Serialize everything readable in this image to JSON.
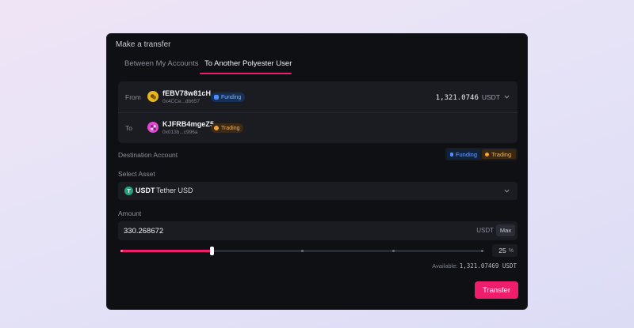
{
  "modal": {
    "title": "Make a transfer"
  },
  "tabs": [
    {
      "label": "Between My Accounts",
      "active": false
    },
    {
      "label": "To Another Polyester User",
      "active": true
    }
  ],
  "from": {
    "label": "From",
    "name": "fEBV78w81cH",
    "address": "0x4CCe...db657",
    "badge": "Funding",
    "balance": "1,321.0746",
    "balance_unit": "USDT",
    "icon": "coins-icon"
  },
  "to": {
    "label": "To",
    "name": "KJFRB4mgeZ5",
    "address": "0x013b...c996a",
    "badge": "Trading",
    "icon": "avatar-icon"
  },
  "destination": {
    "label": "Destination Account",
    "options": [
      "Funding",
      "Trading"
    ],
    "selected": "Trading"
  },
  "asset": {
    "label": "Select Asset",
    "symbol": "USDT",
    "name": "Tether USD",
    "icon_glyph": "T"
  },
  "amount": {
    "label": "Amount",
    "value": "330.268672",
    "unit": "USDT",
    "max_label": "Max",
    "percent": 25,
    "percent_sign": "%",
    "available_label": "Available:",
    "available_value": "1,321.07469 USDT"
  },
  "slider": {
    "marks": [
      0,
      25,
      50,
      75,
      100
    ]
  },
  "submit": {
    "label": "Transfer"
  },
  "colors": {
    "accent": "#ee1e6c",
    "funding": "#4c8dff",
    "trading": "#f0a33a",
    "tether": "#26a17b"
  }
}
